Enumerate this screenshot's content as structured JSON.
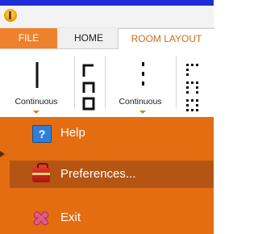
{
  "window": {
    "app_icon": "app-icon"
  },
  "tabs": [
    {
      "label": "FILE"
    },
    {
      "label": "HOME"
    },
    {
      "label": "ROOM LAYOUT"
    }
  ],
  "ribbon": {
    "lines": [
      {
        "label": "Continuous",
        "icon": "vertical-line-icon"
      },
      {
        "label": "",
        "icon": "segmented-line-icon"
      },
      {
        "label": "Continuous",
        "icon": "dotted-line-icon"
      },
      {
        "label": "",
        "icon": "dotted-segmented-line-icon"
      }
    ]
  },
  "menu": {
    "items": [
      {
        "label": "Help",
        "icon": "help-icon"
      },
      {
        "label": "Preferences...",
        "icon": "toolbox-icon"
      },
      {
        "label": "Exit",
        "icon": "exit-icon"
      }
    ],
    "colors": {
      "background": "#e46d12",
      "hover": "#b45514"
    }
  },
  "colors": {
    "accent": "#f0812c",
    "title_strip": "#1e2dd6"
  }
}
